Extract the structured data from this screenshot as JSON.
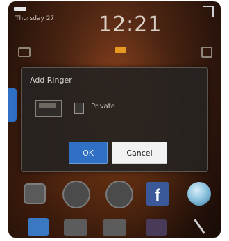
{
  "status": {
    "date": "Thursday 27",
    "time": "12:21",
    "carrier": "",
    "icons": [
      "battery-icon",
      "signal-icon"
    ]
  },
  "dialog": {
    "title": "Add Ringer",
    "option_label": "Private",
    "ok_label": "OK",
    "cancel_label": "Cancel"
  },
  "apps": {
    "row1": [
      "camera-icon",
      "clock-icon",
      "browser-icon",
      "facebook-icon",
      "globe-icon"
    ],
    "facebook_glyph": "f",
    "row2": [
      "calendar-icon",
      "messages-icon",
      "media-icon",
      "app-icon",
      "tools-icon"
    ]
  },
  "colors": {
    "accent": "#2f6fc4",
    "wallpaper": "#4a2412",
    "facebook": "#3b5998"
  }
}
